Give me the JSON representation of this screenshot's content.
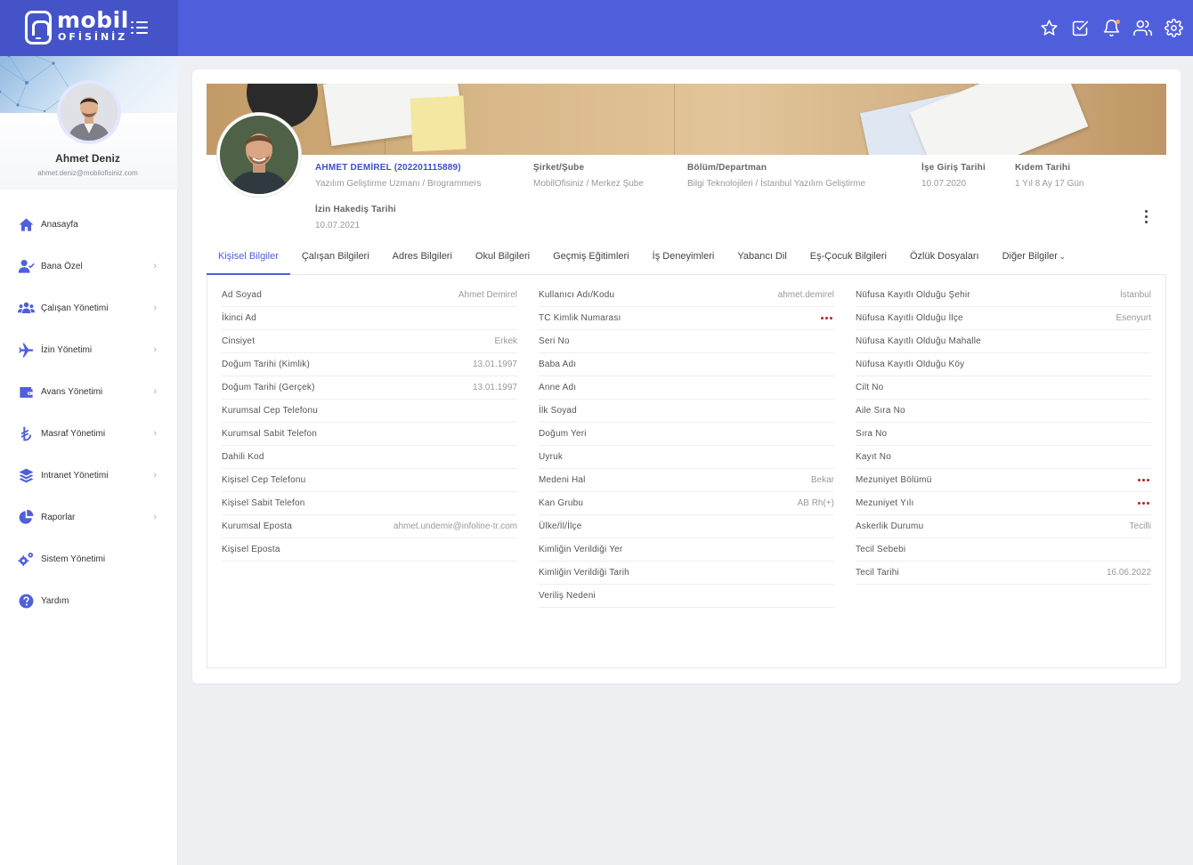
{
  "brand": {
    "word": "mobil",
    "sub": "OFİSİNİZ"
  },
  "topbar": {
    "icons": [
      "star-icon",
      "check-square-icon",
      "bell-icon",
      "users-icon",
      "gear-icon"
    ],
    "accent": "#4f5fdc",
    "notification_dot_color": "#f5a15d"
  },
  "user": {
    "name": "Ahmet Deniz",
    "email": "ahmet.deniz@mobilofisiniz.com"
  },
  "sidebar": {
    "items": [
      {
        "label": "Anasayfa",
        "icon": "home-icon",
        "chevron": false
      },
      {
        "label": "Bana Özel",
        "icon": "user-check-icon",
        "chevron": true
      },
      {
        "label": "Çalışan Yönetimi",
        "icon": "users-icon",
        "chevron": true
      },
      {
        "label": "İzin Yönetimi",
        "icon": "plane-icon",
        "chevron": true
      },
      {
        "label": "Avans Yönetimi",
        "icon": "wallet-icon",
        "chevron": true
      },
      {
        "label": "Masraf Yönetimi",
        "icon": "lira-icon",
        "chevron": true
      },
      {
        "label": "Intranet Yönetimi",
        "icon": "layers-icon",
        "chevron": true
      },
      {
        "label": "Raporlar",
        "icon": "pie-chart-icon",
        "chevron": true
      },
      {
        "label": "Sistem Yönetimi",
        "icon": "cogs-icon",
        "chevron": false
      },
      {
        "label": "Yardım",
        "icon": "help-icon",
        "chevron": false
      }
    ]
  },
  "employee": {
    "name": "AHMET DEMİREL (202201115889)",
    "title": "Yazılım Geliştirme Uzmanı / Brogrammers",
    "company_label": "Şirket/Şube",
    "company": "MobilOfisiniz / Merkez Şube",
    "dept_label": "Bölüm/Departman",
    "dept": "Bilgi Teknolojileri / İstanbul Yazılım Geliştirme",
    "start_label": "İşe Giriş Tarihi",
    "start": "10.07.2020",
    "seniority_label": "Kıdem Tarihi",
    "seniority": "1 Yıl 8 Ay 17 Gün",
    "leave_label": "İzin Hakediş Tarihi",
    "leave": "10.07.2021"
  },
  "tabs": [
    {
      "label": "Kişisel Bilgiler",
      "active": true
    },
    {
      "label": "Çalışan Bilgileri"
    },
    {
      "label": "Adres Bilgileri"
    },
    {
      "label": "Okul Bilgileri"
    },
    {
      "label": "Geçmiş Eğitimleri"
    },
    {
      "label": "İş Deneyimleri"
    },
    {
      "label": "Yabancı Dil"
    },
    {
      "label": "Eş-Çocuk Bilgileri"
    },
    {
      "label": "Özlük Dosyaları"
    },
    {
      "label": "Diğer Bilgiler",
      "dropdown": true
    }
  ],
  "fields": {
    "col1": [
      {
        "label": "Ad Soyad",
        "value": "Ahmet Demirel"
      },
      {
        "label": "İkinci Ad",
        "value": ""
      },
      {
        "label": "Cinsiyet",
        "value": "Erkek"
      },
      {
        "label": "Doğum Tarihi (Kimlik)",
        "value": "13.01.1997"
      },
      {
        "label": "Doğum Tarihi (Gerçek)",
        "value": "13.01.1997"
      },
      {
        "label": "Kurumsal Cep Telefonu",
        "value": ""
      },
      {
        "label": "Kurumsal Sabit Telefon",
        "value": ""
      },
      {
        "label": "Dahili Kod",
        "value": ""
      },
      {
        "label": "Kişisel Cep Telefonu",
        "value": ""
      },
      {
        "label": "Kişisel Sabit Telefon",
        "value": ""
      },
      {
        "label": "Kurumsal Eposta",
        "value": "ahmet.undemir@infoline-tr.com"
      },
      {
        "label": "Kişisel Eposta",
        "value": ""
      }
    ],
    "col2": [
      {
        "label": "Kullanıcı Adı/Kodu",
        "value": "ahmet.demirel"
      },
      {
        "label": "TC Kimlik Numarası",
        "value": "",
        "masked": true
      },
      {
        "label": "Seri No",
        "value": ""
      },
      {
        "label": "Baba Adı",
        "value": ""
      },
      {
        "label": "Anne Adı",
        "value": ""
      },
      {
        "label": "İlk Soyad",
        "value": ""
      },
      {
        "label": "Doğum Yeri",
        "value": ""
      },
      {
        "label": "Uyruk",
        "value": ""
      },
      {
        "label": "Medeni Hal",
        "value": "Bekar"
      },
      {
        "label": "Kan Grubu",
        "value": "AB Rh(+)"
      },
      {
        "label": "Ülke/İl/İlçe",
        "value": ""
      },
      {
        "label": "Kimliğin Verildiği Yer",
        "value": ""
      },
      {
        "label": "Kimliğin Verildiği Tarih",
        "value": ""
      },
      {
        "label": "Veriliş Nedeni",
        "value": ""
      }
    ],
    "col3": [
      {
        "label": "Nüfusa Kayıtlı Olduğu Şehir",
        "value": "İstanbul"
      },
      {
        "label": "Nüfusa Kayıtlı Olduğu İlçe",
        "value": "Esenyurt"
      },
      {
        "label": "Nüfusa Kayıtlı Olduğu Mahalle",
        "value": ""
      },
      {
        "label": "Nüfusa Kayıtlı Olduğu Köy",
        "value": ""
      },
      {
        "label": "Cilt No",
        "value": ""
      },
      {
        "label": "Aile Sıra No",
        "value": ""
      },
      {
        "label": "Sıra No",
        "value": ""
      },
      {
        "label": "Kayıt No",
        "value": ""
      },
      {
        "label": "Mezuniyet Bölümü",
        "value": "",
        "masked": true
      },
      {
        "label": "Mezuniyet Yılı",
        "value": "",
        "masked": true
      },
      {
        "label": "Askerlik Durumu",
        "value": "Tecilli"
      },
      {
        "label": "Tecil Sebebi",
        "value": ""
      },
      {
        "label": "Tecil Tarihi",
        "value": "16.06.2022"
      }
    ]
  }
}
